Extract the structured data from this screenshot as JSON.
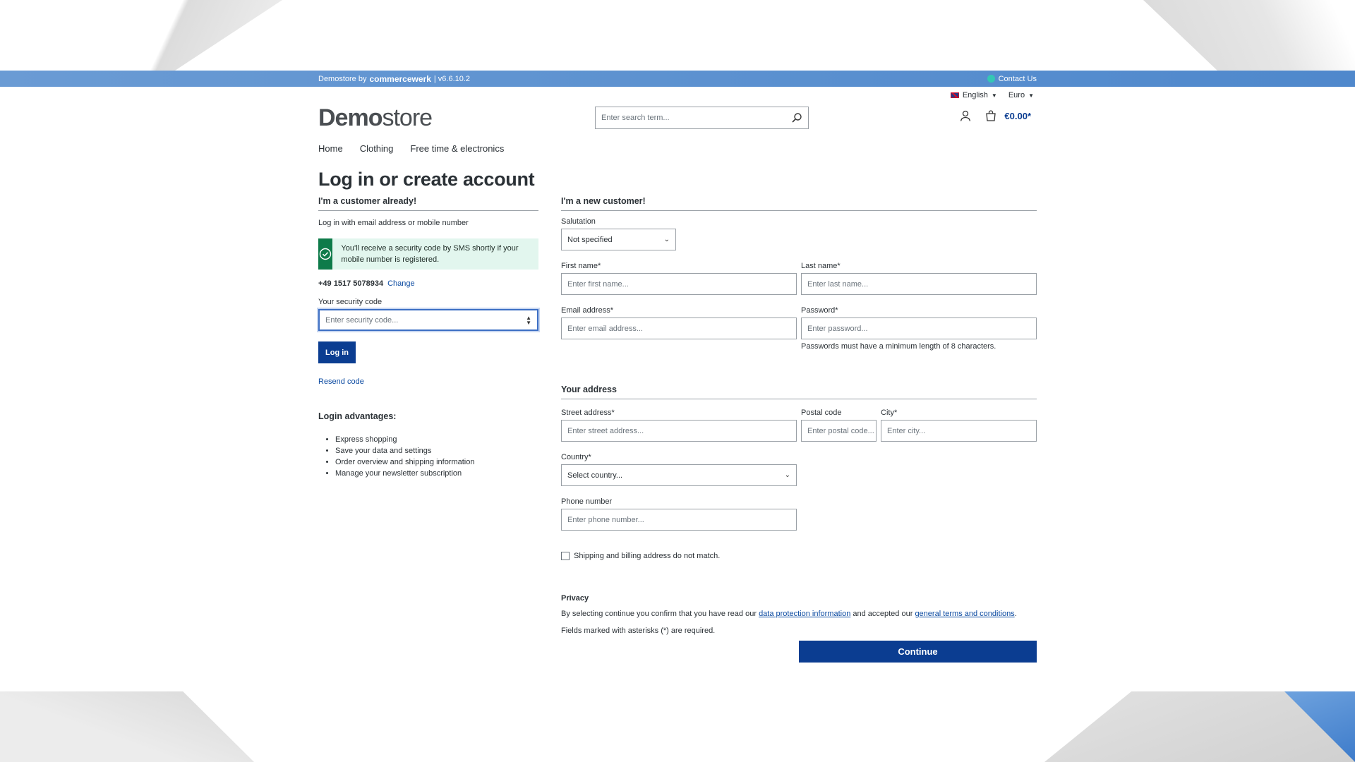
{
  "topbar": {
    "brand_prefix": "Demostore by",
    "brand_name": "commercewerk",
    "version": "| v6.6.10.2",
    "contact": "Contact Us"
  },
  "locale": {
    "language": "English",
    "currency": "Euro"
  },
  "header": {
    "logo_strong": "Demo",
    "logo_light": "store",
    "search_placeholder": "Enter search term...",
    "cart_total": "€0.00*"
  },
  "nav": {
    "items": [
      "Home",
      "Clothing",
      "Free time & electronics"
    ]
  },
  "page": {
    "title": "Log in or create account"
  },
  "login": {
    "heading": "I'm a customer already!",
    "hint": "Log in with email address or mobile number",
    "alert": "You'll receive a security code by SMS shortly if your mobile number is registered.",
    "phone": "+49 1517 5078934",
    "change": "Change",
    "code_label": "Your security code",
    "code_placeholder": "Enter security code...",
    "login_button": "Log in",
    "resend": "Resend code",
    "advantages_title": "Login advantages:",
    "advantages": [
      "Express shopping",
      "Save your data and settings",
      "Order overview and shipping information",
      "Manage your newsletter subscription"
    ]
  },
  "register": {
    "heading": "I'm a new customer!",
    "salutation_label": "Salutation",
    "salutation_value": "Not specified",
    "first_name_label": "First name*",
    "first_name_placeholder": "Enter first name...",
    "last_name_label": "Last name*",
    "last_name_placeholder": "Enter last name...",
    "email_label": "Email address*",
    "email_placeholder": "Enter email address...",
    "password_label": "Password*",
    "password_placeholder": "Enter password...",
    "password_help": "Passwords must have a minimum length of 8 characters.",
    "address_heading": "Your address",
    "street_label": "Street address*",
    "street_placeholder": "Enter street address...",
    "postal_label": "Postal code",
    "postal_placeholder": "Enter postal code...",
    "city_label": "City*",
    "city_placeholder": "Enter city...",
    "country_label": "Country*",
    "country_placeholder": "Select country...",
    "phone_label": "Phone number",
    "phone_placeholder": "Enter phone number...",
    "shipping_checkbox": "Shipping and billing address do not match.",
    "privacy_heading": "Privacy",
    "privacy_pre": "By selecting continue you confirm that you have read our ",
    "privacy_link1": "data protection information",
    "privacy_mid": " and accepted our ",
    "privacy_link2": "general terms and conditions",
    "privacy_post": ".",
    "required_note": "Fields marked with asterisks (*) are required.",
    "continue": "Continue"
  }
}
